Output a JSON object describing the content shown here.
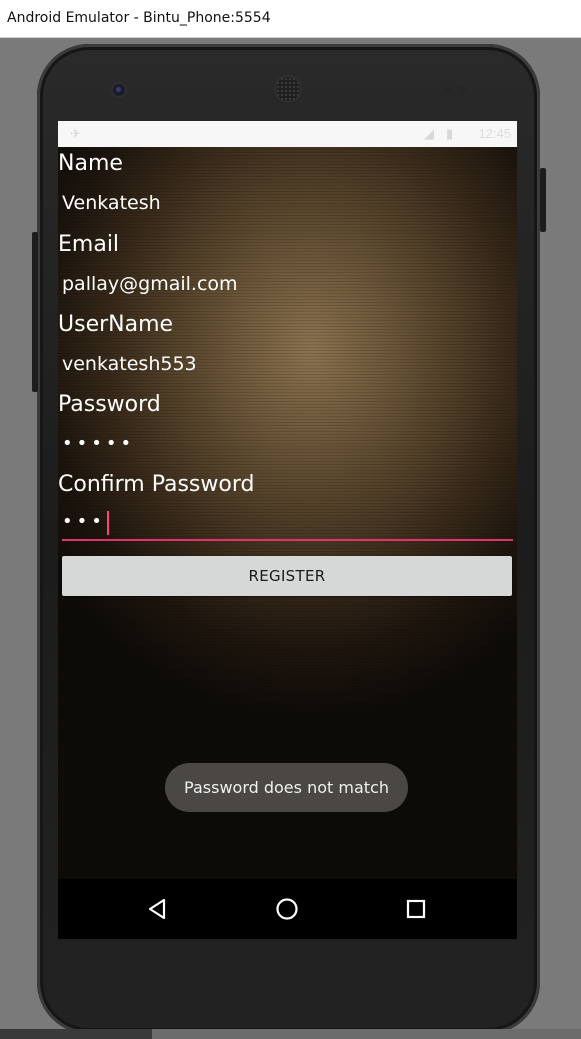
{
  "window": {
    "title": "Android Emulator - Bintu_Phone:5554"
  },
  "status_bar": {
    "time": "12:45"
  },
  "form": {
    "name_label": "Name",
    "name_value": "Venkatesh",
    "email_label": "Email",
    "email_value": "pallay@gmail.com",
    "username_label": "UserName",
    "username_value": "venkatesh553",
    "password_label": "Password",
    "password_value": "•••••",
    "confirm_label": "Confirm Password",
    "confirm_value": "•••",
    "register_label": "REGISTER"
  },
  "toast": {
    "message": "Password does not match"
  },
  "nav": {
    "back_icon": "back-icon",
    "home_icon": "home-icon",
    "recents_icon": "recents-icon"
  },
  "colors": {
    "accent": "#ff4081",
    "button_bg": "#d6d7d7",
    "toast_bg": "#4a4744"
  }
}
